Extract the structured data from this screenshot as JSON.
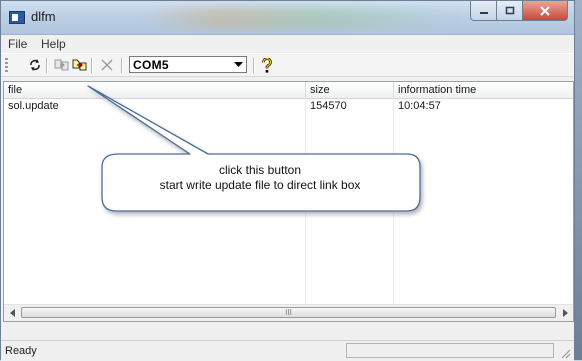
{
  "window": {
    "title": "dlfm",
    "caption_buttons": {
      "minimize": "minimize",
      "maximize": "maximize",
      "close": "close"
    }
  },
  "menu": [
    {
      "label": "File"
    },
    {
      "label": "Help"
    }
  ],
  "toolbar": {
    "buttons": [
      {
        "name": "refresh-icon"
      },
      {
        "name": "copy-file-icon"
      },
      {
        "name": "write-update-icon"
      },
      {
        "name": "delete-icon"
      }
    ],
    "port_selector": {
      "value": "COM5"
    },
    "help_icon": "help-icon"
  },
  "list": {
    "columns": [
      "file",
      "size",
      "information time"
    ],
    "rows": [
      {
        "file": "sol.update",
        "size": "154570",
        "time": "10:04:57"
      }
    ]
  },
  "scrollbar": {
    "thumb_grip": "III"
  },
  "status": {
    "text": "Ready"
  },
  "callout": {
    "line1": "click this button",
    "line2": "start write update file to direct link box"
  }
}
